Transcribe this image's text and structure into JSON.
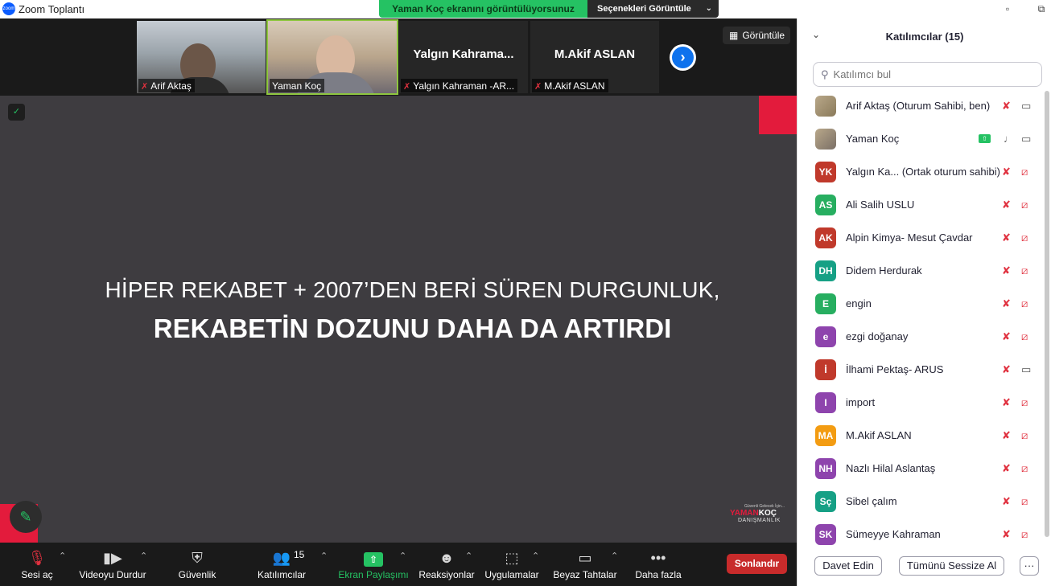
{
  "window": {
    "title": "Zoom Toplantı",
    "logo_text": "zoom",
    "minimize_label": "▫",
    "restore_label": "⧉"
  },
  "share_banner": {
    "status": "Yaman Koç ekranını görüntülüyorsunuz",
    "options_label": "Seçenekleri Görüntüle"
  },
  "thumbnails": [
    {
      "name": "Arif Aktaş",
      "muted": true,
      "video": true
    },
    {
      "name": "Yaman Koç",
      "muted": false,
      "video": true,
      "active": true
    },
    {
      "display": "Yalgın  Kahrama...",
      "name": "Yalgın Kahraman -AR...",
      "muted": true,
      "video": false
    },
    {
      "display": "M.Akif ASLAN",
      "name": "M.Akif ASLAN",
      "muted": true,
      "video": false
    }
  ],
  "view_button": "Görüntüle",
  "slide": {
    "line1": "HİPER REKABET + 2007’DEN BERİ SÜREN DURGUNLUK,",
    "line2": "REKABETİN DOZUNU DAHA DA ARTIRDI",
    "brand_tagline": "Güvenli Gelecek İçin...",
    "brand_name_red": "YAMAN",
    "brand_name_white": "KOÇ",
    "brand_sub": "DANIŞMANLIK"
  },
  "toolbar": {
    "unmute": "Sesi aç",
    "stop_video": "Videoyu Durdur",
    "security": "Güvenlik",
    "participants": "Katılımcılar",
    "participants_count": "15",
    "share_screen": "Ekran Paylaşımı",
    "reactions": "Reaksiyonlar",
    "apps": "Uygulamalar",
    "whiteboards": "Beyaz Tahtalar",
    "more": "Daha fazla",
    "end": "Sonlandır"
  },
  "panel": {
    "title": "Katılımcılar (15)",
    "search_placeholder": "Katılımcı bul",
    "invite": "Davet Edin",
    "mute_all": "Tümünü Sessize Al",
    "more": "···",
    "participants": [
      {
        "name": "Arif Aktaş (Oturum Sahibi, ben)",
        "initials": "",
        "color": "#8a7a5a",
        "mic": "off",
        "cam": "on",
        "photo": true
      },
      {
        "name": "Yaman Koç",
        "initials": "",
        "color": "#7a6f66",
        "mic": "on",
        "cam": "on",
        "photo": true,
        "sharing": true
      },
      {
        "name": "Yalgın Ka... (Ortak oturum sahibi)",
        "initials": "YK",
        "color": "#c0392b",
        "mic": "off",
        "cam": "off"
      },
      {
        "name": "Ali Salih USLU",
        "initials": "AS",
        "color": "#27ae60",
        "mic": "off",
        "cam": "off"
      },
      {
        "name": "Alpin Kimya- Mesut Çavdar",
        "initials": "AK",
        "color": "#c0392b",
        "mic": "off",
        "cam": "off"
      },
      {
        "name": "Didem Herdurak",
        "initials": "DH",
        "color": "#16a085",
        "mic": "off",
        "cam": "off"
      },
      {
        "name": "engin",
        "initials": "E",
        "color": "#27ae60",
        "mic": "off",
        "cam": "off"
      },
      {
        "name": "ezgi doğanay",
        "initials": "e",
        "color": "#8e44ad",
        "mic": "off",
        "cam": "off"
      },
      {
        "name": "İlhami Pektaş- ARUS",
        "initials": "İ",
        "color": "#c0392b",
        "mic": "off",
        "cam": "on"
      },
      {
        "name": "import",
        "initials": "I",
        "color": "#8e44ad",
        "mic": "off",
        "cam": "off"
      },
      {
        "name": "M.Akif ASLAN",
        "initials": "MA",
        "color": "#f39c12",
        "mic": "off",
        "cam": "off"
      },
      {
        "name": "Nazlı Hilal Aslantaş",
        "initials": "NH",
        "color": "#8e44ad",
        "mic": "off",
        "cam": "off"
      },
      {
        "name": "Sibel çalım",
        "initials": "Sç",
        "color": "#16a085",
        "mic": "off",
        "cam": "off"
      },
      {
        "name": "Sümeyye Kahraman",
        "initials": "SK",
        "color": "#8e44ad",
        "mic": "off",
        "cam": "off"
      }
    ]
  }
}
